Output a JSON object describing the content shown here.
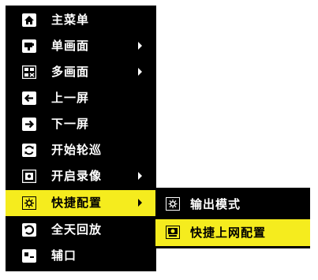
{
  "main_menu": {
    "items": [
      {
        "label": "主菜单",
        "icon": "home-icon",
        "has_submenu": false
      },
      {
        "label": "单画面",
        "icon": "single-screen-icon",
        "has_submenu": true
      },
      {
        "label": "多画面",
        "icon": "multi-screen-icon",
        "has_submenu": true
      },
      {
        "label": "上一屏",
        "icon": "arrow-left-icon",
        "has_submenu": false
      },
      {
        "label": "下一屏",
        "icon": "arrow-right-icon",
        "has_submenu": false
      },
      {
        "label": "开始轮巡",
        "icon": "refresh-cycle-icon",
        "has_submenu": false
      },
      {
        "label": "开启录像",
        "icon": "record-icon",
        "has_submenu": true
      },
      {
        "label": "快捷配置",
        "icon": "settings-gear-icon",
        "has_submenu": true,
        "selected": true
      },
      {
        "label": "全天回放",
        "icon": "playback-icon",
        "has_submenu": false
      },
      {
        "label": "辅口",
        "icon": "aux-port-icon",
        "has_submenu": false
      }
    ]
  },
  "sub_menu": {
    "items": [
      {
        "label": "输出模式",
        "icon": "output-mode-icon"
      },
      {
        "label": "快捷上网配置",
        "icon": "network-config-icon",
        "selected": true
      }
    ]
  },
  "colors": {
    "menu_background": "#000000",
    "selected_background": "#f5ec1e",
    "text": "#ffffff",
    "selected_text": "#000000"
  }
}
